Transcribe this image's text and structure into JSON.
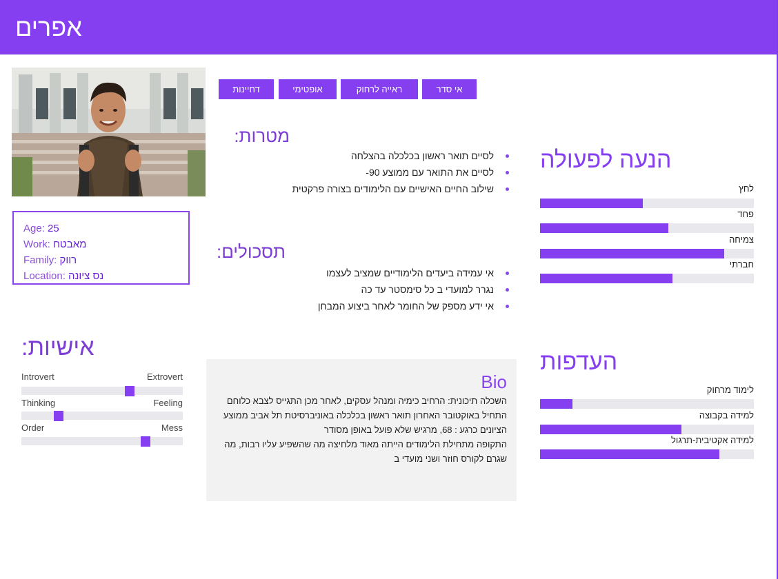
{
  "persona": {
    "name": "אפרים"
  },
  "info": {
    "age_label": "Age: ",
    "age_value": "25",
    "work_label": "Work: ",
    "work_value": "מאבטח",
    "family_label": "Family: ",
    "family_value": "רווק",
    "location_label": "Location: ",
    "location_value": "נס ציונה"
  },
  "tags": [
    "אי סדר",
    "ראייה לרחוק",
    "אופטימי",
    "דחיינות"
  ],
  "goals": {
    "title": "מטרות:",
    "items": [
      "לסיים תואר ראשון בכלכלה בהצלחה",
      "לסיים את התואר עם ממוצע 90-",
      "שילוב החיים האישיים עם הלימודים בצורה פרקטית"
    ]
  },
  "frustrations": {
    "title": "תסכולים:",
    "items": [
      "אי עמידה ביעדים הלימודיים שמציב לעצמו",
      "נגרר למועדי ב כל סימסטר עד כה",
      "אי ידע מספק של החומר לאחר ביצוע המבחן"
    ]
  },
  "motivation": {
    "title": "הנעה לפעולה",
    "bars": [
      {
        "label": "לחץ",
        "value": 0.48
      },
      {
        "label": "פחד",
        "value": 0.6
      },
      {
        "label": "צמיחה",
        "value": 0.86
      },
      {
        "label": "חברתי",
        "value": 0.62
      }
    ]
  },
  "preferences": {
    "title": "העדפות",
    "bars": [
      {
        "label": "לימוד מרחוק",
        "value": 0.15
      },
      {
        "label": "למידה בקבוצה",
        "value": 0.66
      },
      {
        "label": "למידה אקטיבית-תרגול",
        "value": 0.84
      }
    ]
  },
  "personality": {
    "title": "אישיות:",
    "traits": [
      {
        "left": "Introvert",
        "right": "Extrovert",
        "value": 0.67
      },
      {
        "left": "Thinking",
        "right": "Feeling",
        "value": 0.23
      },
      {
        "left": "Order",
        "right": "Mess",
        "value": 0.77
      }
    ]
  },
  "bio": {
    "title": "Bio",
    "lines": [
      "השכלה תיכונית: הרחיב כימיה ומנהל עסקים, לאחר מכן התגייס לצבא כלוחם",
      "התחיל באוקטובר האחרון תואר ראשון בכלכלה באוניברסיטת תל אביב ממוצע הציונים כרגע : 68, מרגיש שלא פועל באופן מסודר",
      "התקופה מתחילת הלימודים הייתה מאוד מלחיצה מה שהשפיע עליו רבות, מה שגרם לקורס חוזר ושני מועדי ב"
    ]
  },
  "colors": {
    "accent": "#853ef0",
    "track": "#e9e8ec",
    "bio_bg": "#f2f2f2"
  }
}
